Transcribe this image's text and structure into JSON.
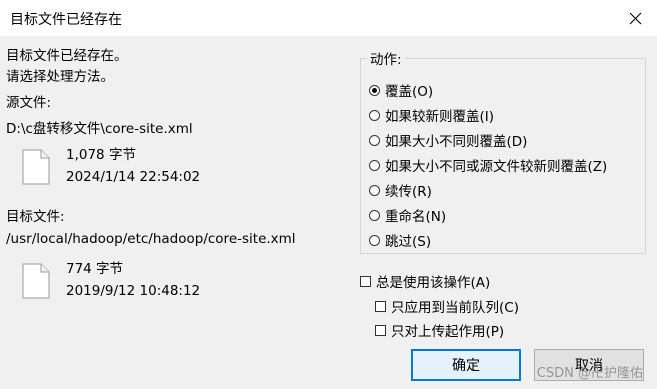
{
  "window": {
    "title": "目标文件已经存在"
  },
  "message": {
    "line1": "目标文件已经存在。",
    "line2": "请选择处理方法。"
  },
  "source": {
    "label": "源文件:",
    "path": "D:\\c盘转移文件\\core-site.xml",
    "size": "1,078 字节",
    "modified": "2024/1/14 22:54:02",
    "icon": "file-icon"
  },
  "target": {
    "label": "目标文件:",
    "path": "/usr/local/hadoop/etc/hadoop/core-site.xml",
    "size": "774 字节",
    "modified": "2019/9/12 10:48:12",
    "icon": "file-icon"
  },
  "actions": {
    "label": "动作:",
    "selected": "覆盖(O)",
    "options": [
      "覆盖(O)",
      "如果较新则覆盖(I)",
      "如果大小不同则覆盖(D)",
      "如果大小不同或源文件较新则覆盖(Z)",
      "续传(R)",
      "重命名(N)",
      "跳过(S)"
    ]
  },
  "options": {
    "always": "总是使用该操作(A)",
    "current_queue": "只应用到当前队列(C)",
    "upload_only": "只对上传起作用(P)"
  },
  "buttons": {
    "ok": "确定",
    "cancel": "取消"
  },
  "watermark": "CSDN @卍护隆佑",
  "colors": {
    "accent": "#0078d7",
    "background": "#f0f0f0"
  }
}
